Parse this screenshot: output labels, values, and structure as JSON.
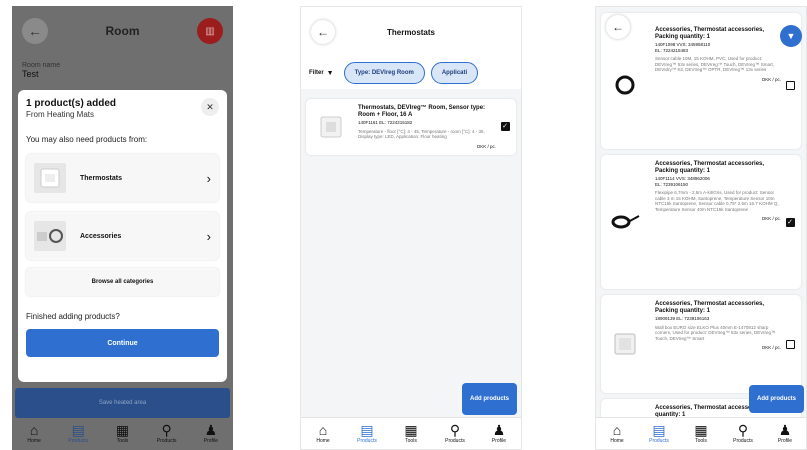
{
  "nav_items": [
    {
      "label": "Home",
      "icon": "home-icon"
    },
    {
      "label": "Products",
      "icon": "document-icon"
    },
    {
      "label": "Tools",
      "icon": "grid-icon"
    },
    {
      "label": "Products",
      "icon": "search-icon"
    },
    {
      "label": "Profile",
      "icon": "person-icon"
    }
  ],
  "screen1": {
    "title": "Room",
    "field_label": "Room name",
    "field_value": "Test",
    "modal": {
      "title": "1 product(s) added",
      "subtitle": "From Heating Mats",
      "hint": "You may also need products from:",
      "categories": [
        {
          "label": "Thermostats"
        },
        {
          "label": "Accessories"
        }
      ],
      "browse_label": "Browse all categories",
      "finish_text": "Finished adding products?",
      "continue_label": "Continue"
    },
    "save_label": "Save heated area"
  },
  "screen2": {
    "title": "Thermostats",
    "filter_label": "Filter",
    "chips": [
      "Type: DEVIreg Room",
      "Applicati"
    ],
    "product": {
      "name": "Thermostats, DEVIreg™ Room, Sensor type: Room + Floor, 16 A",
      "codes": "140F1161  EL: 7224215182",
      "desc": "Temperature - floor [°C]: 4 - 45, Temperature - room [°C]: 4 - 35, Display type: LED, Application: Floor heating",
      "unit": "DKK / pc."
    },
    "add_label": "Add products"
  },
  "screen3": {
    "products": [
      {
        "name": "Accessories, Thermostat accessories, Packing quantity: 1",
        "codes": "140F1098  VVS: 345958110\nEL: 7224215483",
        "desc": "Sensor cable 10M, 15 KOHM, PVC, Used for product: DEVIreg™ 53x series, DEVIreg™ Touch, DEVIreg™ Smart, DEVIdry™ Kit, DEVIreg™ OPTR, DEVIreg™ 13x series",
        "unit": "DKK / pc.",
        "checked": false
      },
      {
        "name": "Accessories, Thermostat accessories, Packing quantity: 1",
        "codes": "140F1114  VVS: 348962006\nEL: 7239106150",
        "desc": "Flexipipe 6,7mm - 2,5m A-kit/Gris, Used for product: Sensor cable 3 m 15 KOHM, Santoprene, Temperature Sensor 10m NTC15k Santoprene, Sensor cable 0.75* 2.5m 16.7 KOHM Q, Temperature Sensor 40m NTC15k Santoprene",
        "unit": "DKK / pc.",
        "checked": true
      },
      {
        "name": "Accessories, Thermostat accessories, Packing quantity: 1",
        "codes": "18909139  EL: 7239106163",
        "desc": "Wall box EURO size ELKO Plus 40mm E-1470812 sharp corners, Used for product: DEVIreg™ 53x series, DEVIreg™ Touch, DEVIreg™ Smart",
        "unit": "DKK / pc.",
        "checked": false
      },
      {
        "name": "Accessories, Thermostat accessories, Packing quantity: 1",
        "codes": "",
        "desc": "",
        "unit": "",
        "checked": false
      }
    ],
    "add_label": "Add products"
  },
  "colors": {
    "accent": "#2f6fd0",
    "danger": "#9b1d1d",
    "overlay": "#6f6f6f"
  }
}
